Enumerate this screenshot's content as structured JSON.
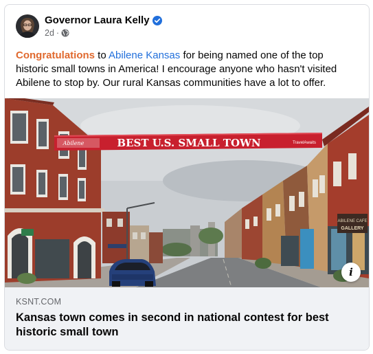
{
  "post": {
    "author": "Governor Laura Kelly",
    "timestamp": "2d",
    "audience_icon": "globe-icon",
    "verified_icon": "verified-badge-icon",
    "text": {
      "highlight": "Congratulations",
      "part1": " to ",
      "tag": "Abilene Kansas",
      "part2": " for being named one of the top historic small towns in America! I encourage anyone who hasn't visited Abilene to stop by. Our rural Kansas communities have a lot to offer."
    }
  },
  "photo": {
    "banner_text": "BEST U.S. SMALL TOWN",
    "banner_left_text": "Abilene",
    "banner_right_text": "TravelAwaits",
    "sign_cafe": "ABILENE CAFE",
    "sign_gallery": "GALLERY",
    "info_icon": "i"
  },
  "link_preview": {
    "domain": "KSNT.COM",
    "title": "Kansas town comes in second in national contest for best historic small town"
  },
  "colors": {
    "accent_blue": "#216fdb",
    "highlight_orange": "#e0692e",
    "banner_red": "#c8202e"
  }
}
